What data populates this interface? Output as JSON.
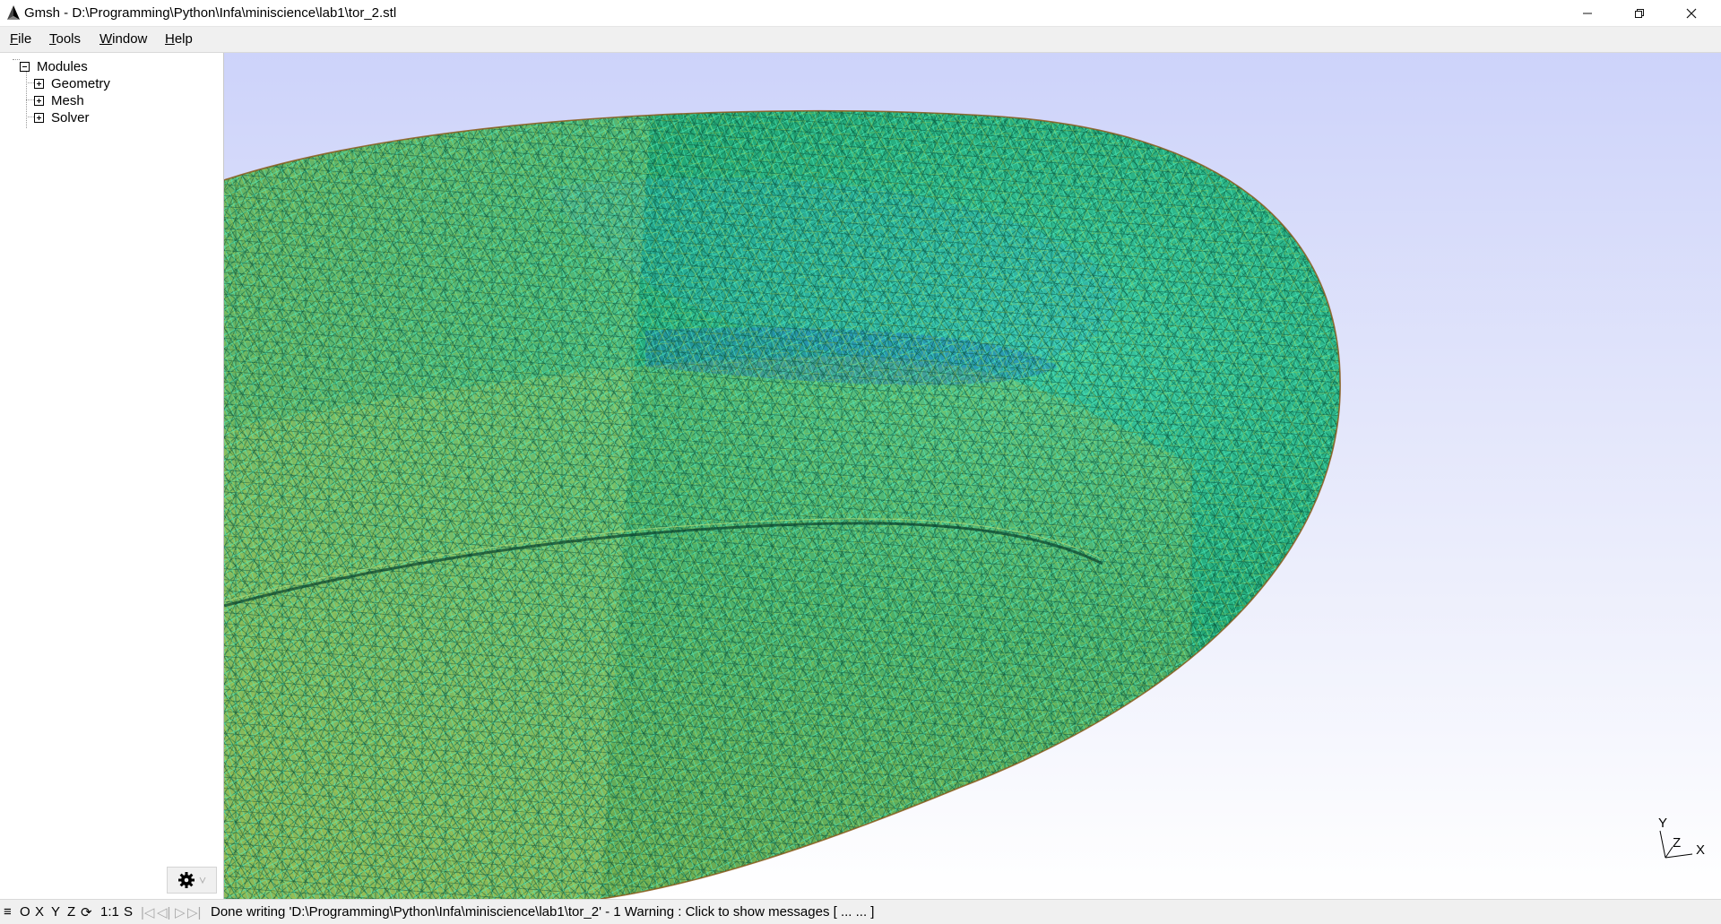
{
  "window": {
    "title": "Gmsh - D:\\Programming\\Python\\Infa\\miniscience\\lab1\\tor_2.stl"
  },
  "menu": {
    "items": [
      {
        "label": "File",
        "mnemonic": "F",
        "rest": "ile"
      },
      {
        "label": "Tools",
        "mnemonic": "T",
        "rest": "ools"
      },
      {
        "label": "Window",
        "mnemonic": "W",
        "rest": "indow"
      },
      {
        "label": "Help",
        "mnemonic": "H",
        "rest": "elp"
      }
    ]
  },
  "tree": {
    "root": {
      "label": "Modules",
      "expanded": true
    },
    "children": [
      {
        "label": "Geometry",
        "expanded": false
      },
      {
        "label": "Mesh",
        "expanded": false
      },
      {
        "label": "Solver",
        "expanded": false
      }
    ]
  },
  "axes": {
    "y": "Y",
    "z": "Z",
    "x": "X"
  },
  "statusbar": {
    "menu_glyph": "≡",
    "o": "O",
    "x": "X",
    "y": "Y",
    "z": "Z",
    "rotate_glyph": "⟳",
    "scale": "1:1",
    "s": "S",
    "first_glyph": "|◁",
    "prev_glyph": "◁|",
    "play_glyph": "▷",
    "last_glyph": "▷|",
    "message": "Done writing 'D:\\Programming\\Python\\Infa\\miniscience\\lab1\\tor_2'  -  1 Warning : Click to show messages [ ...  ... ]"
  },
  "colors": {
    "viewport_top": "#cdd3fa",
    "viewport_bottom": "#ffffff",
    "mesh_green": "#1aa86c",
    "mesh_teal": "#27d0a8",
    "mesh_yellow": "#c7d43a",
    "mesh_blue": "#2a7fd6",
    "mesh_edge": "#8a5a1a"
  }
}
